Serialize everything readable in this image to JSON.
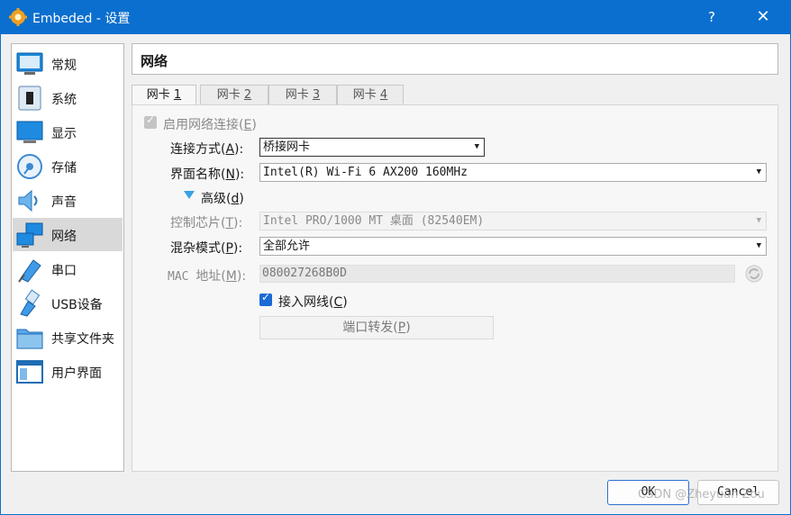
{
  "window": {
    "title": "Embeded - 设置",
    "help": "?",
    "close": "✕"
  },
  "sidebar": {
    "items": [
      {
        "label": "常规",
        "icon": "general-settings-icon"
      },
      {
        "label": "系统",
        "icon": "system-chip-icon"
      },
      {
        "label": "显示",
        "icon": "display-monitor-icon"
      },
      {
        "label": "存储",
        "icon": "storage-disk-icon"
      },
      {
        "label": "声音",
        "icon": "speaker-icon"
      },
      {
        "label": "网络",
        "icon": "network-icon",
        "selected": true
      },
      {
        "label": "串口",
        "icon": "serial-port-icon"
      },
      {
        "label": "USB设备",
        "icon": "usb-icon"
      },
      {
        "label": "共享文件夹",
        "icon": "shared-folder-icon"
      },
      {
        "label": "用户界面",
        "icon": "user-interface-icon"
      }
    ]
  },
  "header": {
    "title": "网络"
  },
  "tabs": [
    {
      "label": "网卡 ",
      "key": "1"
    },
    {
      "label": "网卡 ",
      "key": "2"
    },
    {
      "label": "网卡 ",
      "key": "3"
    },
    {
      "label": "网卡 ",
      "key": "4"
    }
  ],
  "adapter": {
    "enable_label": "启用网络连接(",
    "enable_key": "E",
    "enable_close": ")",
    "attached_label": "连接方式(",
    "attached_key": "A",
    "attached_close": "):",
    "attached_value": "桥接网卡",
    "name_label": "界面名称(",
    "name_key": "N",
    "name_close": "):",
    "name_value": "Intel(R) Wi-Fi 6 AX200 160MHz",
    "advanced_label": "高级(",
    "advanced_key": "d",
    "advanced_close": ")",
    "chip_label": "控制芯片(",
    "chip_key": "T",
    "chip_close": "):",
    "chip_value_a": "Intel PRO/1000 MT ",
    "chip_value_b": "桌面",
    "chip_value_c": " (82540EM)",
    "promisc_label": "混杂模式(",
    "promisc_key": "P",
    "promisc_close": "):",
    "promisc_value": "全部允许",
    "mac_label_a": "MAC ",
    "mac_label_b": "地址(",
    "mac_key": "M",
    "mac_close": "):",
    "mac_value": "080027268B0D",
    "cable_label": "接入网线(",
    "cable_key": "C",
    "cable_close": ")",
    "port_label": "端口转发(",
    "port_key": "P",
    "port_close": ")"
  },
  "buttons": {
    "ok": "OK",
    "cancel": "Cancel"
  },
  "watermark": "CSDN @Zheyuan Zou",
  "colors": {
    "titlebar": "#0b6fcf",
    "selected_item": "#d9d9d9",
    "checkbox_on": "#1b6ad5"
  }
}
